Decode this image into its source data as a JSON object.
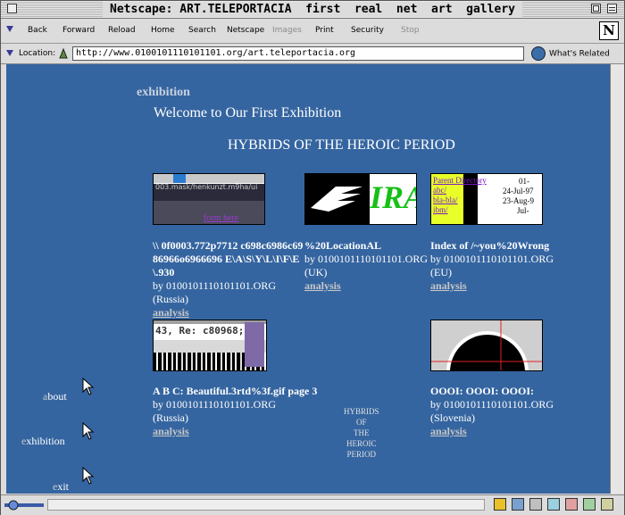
{
  "window": {
    "title": "Netscape: ART.TELEPORTACIA  first  real  net  art  gallery"
  },
  "toolbar": {
    "buttons": [
      {
        "label": "Back",
        "enabled": true
      },
      {
        "label": "Forward",
        "enabled": true
      },
      {
        "label": "Reload",
        "enabled": true
      },
      {
        "label": "Home",
        "enabled": true
      },
      {
        "label": "Search",
        "enabled": true
      },
      {
        "label": "Netscape",
        "enabled": true
      },
      {
        "label": "Images",
        "enabled": false
      },
      {
        "label": "Print",
        "enabled": true
      },
      {
        "label": "Security",
        "enabled": true
      },
      {
        "label": "Stop",
        "enabled": false
      }
    ],
    "logo": "N"
  },
  "location": {
    "label": "Location:",
    "url": "http://www.0100101110101101.org/art.teleportacia.org",
    "related": "What's Related"
  },
  "page": {
    "section": "exhibition",
    "welcome": "Welcome to Our First Exhibition",
    "exhibit_title": "HYBRIDS OF THE HEROIC PERIOD",
    "items": [
      {
        "title": "\\\\ 0f0003.772p7712 c698c6986c6986966o6966696 E\\A\\S\\Y\\L\\I\\F\\E\\.930",
        "by": "by 0100101110101101.ORG",
        "origin": "(Russia)",
        "link": "analysis",
        "thumb_caption": "form here",
        "thumb_text": "003.mask/henkunzt.m9ha/ui"
      },
      {
        "title": "%20LocationAL",
        "by": "by 0100101110101101.ORG",
        "origin": "(UK)",
        "link": "analysis",
        "thumb_text": "IRA"
      },
      {
        "title": "Index of /~you%20Wrong",
        "by": "by 0100101110101101.ORG",
        "origin": "(EU)",
        "link": "analysis",
        "thumb_lines": [
          "Parent Directory",
          "abc/",
          "bla-bla/",
          "ibm/",
          "01-",
          "24-Jul-97",
          "23-Aug-9",
          "Jul-"
        ]
      },
      {
        "title": "A B C: Beautiful.3rtd%3f.gif page 3",
        "by": "by 0100101110101101.ORG",
        "origin": "(Russia)",
        "link": "analysis",
        "thumb_text": "43, Re: c80968;686"
      },
      {
        "title": "OOOI: OOOI: OOOI:",
        "by": "by 0100101110101101.ORG",
        "origin": "(Slovenia)",
        "link": "analysis"
      }
    ],
    "mini_title": [
      "HYBRIDS",
      "OF",
      "THE",
      "HEROIC",
      "PERIOD"
    ],
    "nav": [
      {
        "first": "a",
        "rest": "bout"
      },
      {
        "first": "e",
        "rest": "xhibition"
      },
      {
        "first": "e",
        "rest": "xit"
      }
    ]
  }
}
